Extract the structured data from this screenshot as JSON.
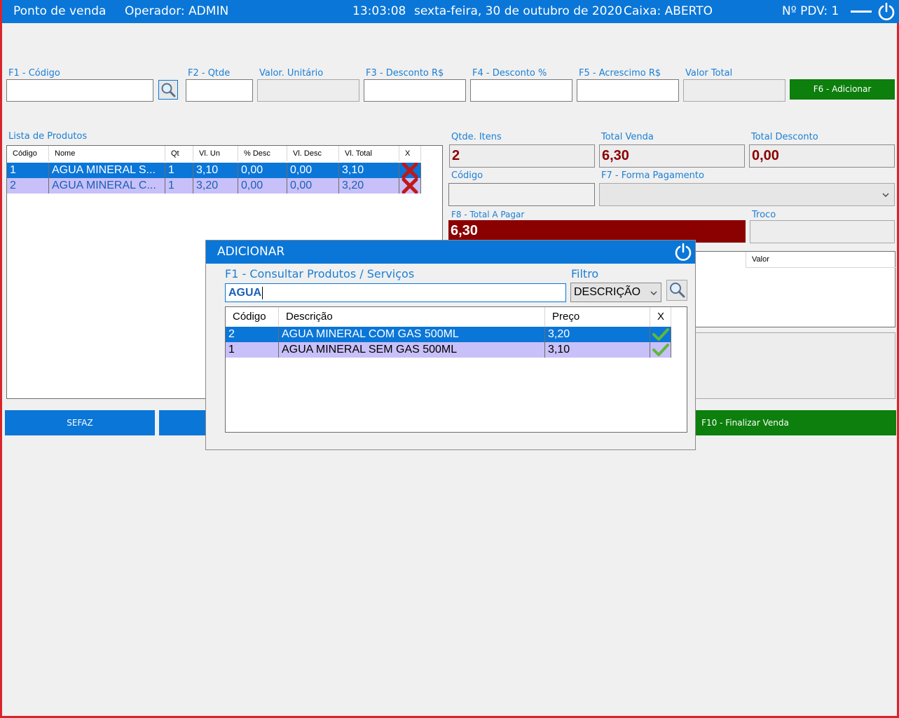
{
  "topbar": {
    "app_title": "Ponto de venda",
    "operator": "Operador: ADMIN",
    "time": "13:03:08",
    "date": "sexta-feira, 30 de outubro de 2020",
    "cashier": "Caixa: ABERTO",
    "pdv": "Nº PDV: 1"
  },
  "form": {
    "code_label": "F1 - Código",
    "qty_label": "F2 - Qtde",
    "unit_value_label": "Valor. Unitário",
    "discount_rs_label": "F3 - Desconto R$",
    "discount_pct_label": "F4 - Desconto  %",
    "surcharge_label": "F5 - Acrescimo R$",
    "total_value_label": "Valor Total",
    "add_button": "F6 - Adicionar"
  },
  "products": {
    "title": "Lista de Produtos",
    "columns": [
      "Código",
      "Nome",
      "Qt",
      "Vl. Un",
      "% Desc",
      "Vl. Desc",
      "Vl. Total",
      "X"
    ],
    "rows": [
      {
        "codigo": "1",
        "nome": "AGUA MINERAL S...",
        "qt": "1",
        "vl_un": "3,10",
        "pct_desc": "0,00",
        "vl_desc": "0,00",
        "vl_total": "3,10"
      },
      {
        "codigo": "2",
        "nome": "AGUA MINERAL C...",
        "qt": "1",
        "vl_un": "3,20",
        "pct_desc": "0,00",
        "vl_desc": "0,00",
        "vl_total": "3,20"
      }
    ]
  },
  "summary": {
    "qty_items_label": "Qtde. Itens",
    "qty_items": "2",
    "total_sale_label": "Total Venda",
    "total_sale": "6,30",
    "total_discount_label": "Total Desconto",
    "total_discount": "0,00",
    "code_label": "Código",
    "payment_label": "F7 - Forma Pagamento",
    "total_pay_label": "F8 - Total A Pagar",
    "total_pay": "6,30",
    "change_label": "Troco",
    "payments_value_header": "Valor"
  },
  "bottom_buttons": {
    "sefaz": "SEFAZ",
    "finalize": "F10 - Finalizar Venda"
  },
  "modal": {
    "title": "ADICIONAR",
    "search_label": "F1 - Consultar Produtos / Serviços",
    "search_value": "AGUA",
    "filter_label": "Filtro",
    "filter_value": "DESCRIÇÃO",
    "columns": [
      "Código",
      "Descrição",
      "Preço",
      "X"
    ],
    "rows": [
      {
        "codigo": "2",
        "descricao": "AGUA MINERAL COM GAS 500ML",
        "preco": "3,20"
      },
      {
        "codigo": "1",
        "descricao": "AGUA MINERAL SEM GAS 500ML",
        "preco": "3,10"
      }
    ]
  },
  "icons": {
    "power": "power-icon",
    "search": "magnifier-icon",
    "delete": "red-x-icon",
    "select": "green-check-icon",
    "dropdown": "chevron-down-icon"
  },
  "colors": {
    "brand_blue": "#0a76d8",
    "green": "#0c7f0c",
    "dark_red": "#8b0000",
    "alt_row": "#c8c0f8"
  }
}
